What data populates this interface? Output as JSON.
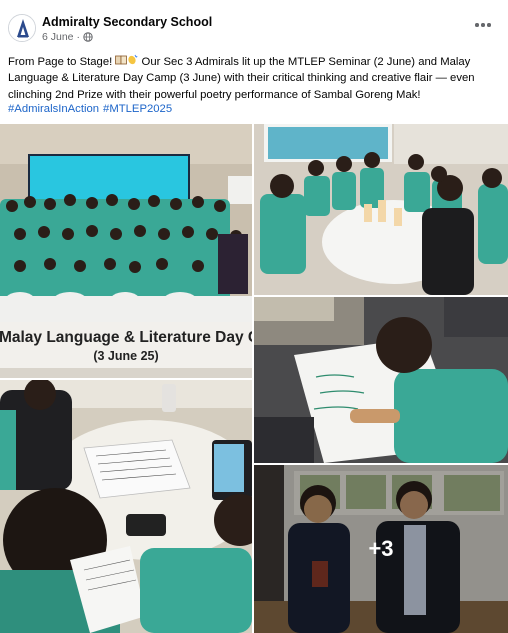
{
  "post": {
    "page_name": "Admiralty Secondary School",
    "date": "6 June",
    "date_separator": "·",
    "caption_part1": "From Page to Stage! ",
    "caption_part2": " Our Sec 3 Admirals lit up the MTLEP Seminar (2 June) and Malay Language & Literature Day Camp (3 June) with their critical thinking and creative flair — even clinching 2nd Prize with their powerful poetry performance of Sambal Goreng Mak!",
    "hashtags": [
      "#AdmiralsInAction",
      "#MTLEP2025"
    ]
  },
  "icons": {
    "avatar": "school-crest-icon",
    "audience": "globe-icon",
    "menu": "more-options-icon",
    "emoji1": "book-emoji",
    "emoji2": "clapping-hands-emoji"
  },
  "photos": {
    "banner_line1": "Malay Language & Literature Day C",
    "banner_line2": "(3 June 25)",
    "more_count": "+3"
  },
  "colors": {
    "link": "#1d65c9",
    "text": "#050505",
    "meta": "#65676b",
    "uniform": "#3aa896"
  }
}
